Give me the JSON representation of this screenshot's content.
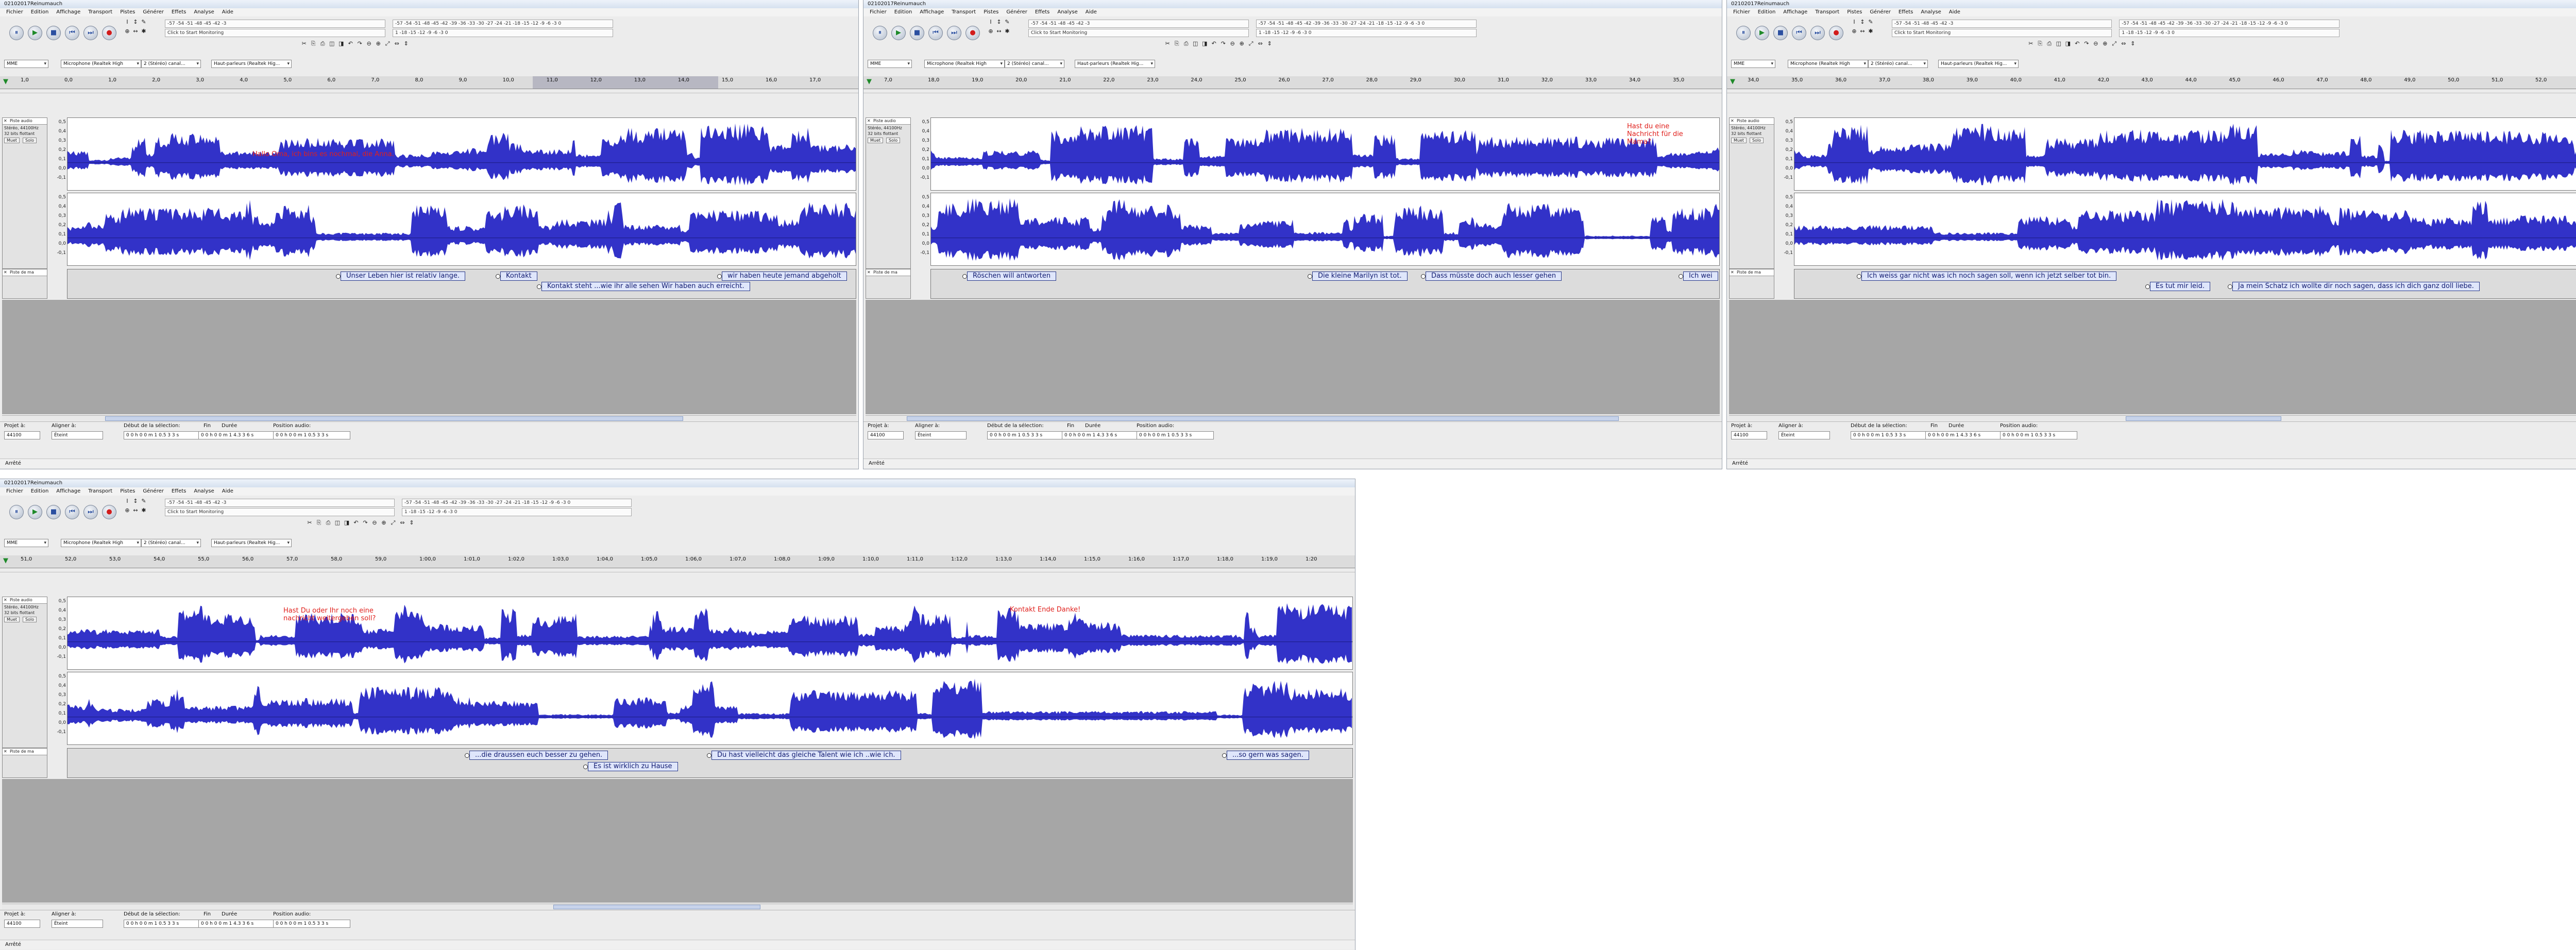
{
  "app": {
    "title": "02102017Reinumauch",
    "status": "Arrêté",
    "menus": [
      "Fichier",
      "Edition",
      "Affichage",
      "Transport",
      "Pistes",
      "Générer",
      "Effets",
      "Analyse",
      "Aide"
    ]
  },
  "toolbar": {
    "pause_icon": "pause-icon",
    "play_icon": "play-icon",
    "stop_icon": "stop-icon",
    "skip_start_icon": "skip-start-icon",
    "skip_end_icon": "skip-end-icon",
    "record_icon": "record-icon",
    "record_meter_text": "-57 -54 -51 -48 -45 -42 -3",
    "monitor_label": "Click to Start Monitoring",
    "record_meter_tail": "1 -18 -15 -12 -9 -6 -3 0",
    "play_meter_text": "-57 -54 -51 -48 -45 -42 -39 -36 -33 -30 -27 -24 -21 -18 -15 -12 -9 -6 -3 0",
    "host": "MME",
    "input_device": "Microphone (Realtek High",
    "channels": "2 (Stéréo) canal...",
    "output_device": "Haut-parleurs (Realtek Hig..."
  },
  "track": {
    "audio_name": "Piste audio",
    "audio_info_1": "Stéréo, 44100Hz",
    "audio_info_2": "32 bits flottant",
    "mute": "Muet",
    "solo": "Solo",
    "label_name": "Piste de ma"
  },
  "scale": [
    "0,5",
    "0,4",
    "0,3",
    "0,2",
    "0,1",
    "0,0",
    "-0,1"
  ],
  "windows": [
    {
      "ruler": [
        "1,0",
        "0,0",
        "1,0",
        "2,0",
        "3,0",
        "4,0",
        "5,0",
        "6,0",
        "7,0",
        "8,0",
        "9,0",
        "10,0",
        "11,0",
        "12,0",
        "13,0",
        "14,0",
        "15,0",
        "16,0",
        "17,0"
      ],
      "annotations": [
        {
          "text": "Hallo Oma, ich bins es nochmal, die Anna."
        }
      ],
      "labels": [
        {
          "text": "Unser Leben hier ist relativ lange."
        },
        {
          "text": "Kontakt"
        },
        {
          "text": "Kontakt steht ...wie ihr alle sehen Wir haben  auch erreicht."
        },
        {
          "text": "wir haben heute jemand abgeholt"
        }
      ]
    },
    {
      "ruler": [
        "7,0",
        "18,0",
        "19,0",
        "20,0",
        "21,0",
        "22,0",
        "23,0",
        "24,0",
        "25,0",
        "26,0",
        "27,0",
        "28,0",
        "29,0",
        "30,0",
        "31,0",
        "32,0",
        "33,0",
        "34,0",
        "35,0"
      ],
      "annotations": [
        {
          "text": "Hast du eine Nachricht für die Mama?"
        }
      ],
      "labels": [
        {
          "text": "Röschen will antworten"
        },
        {
          "text": "Die kleine Marilyn ist tot."
        },
        {
          "text": "Dass müsste doch auch lesser gehen"
        },
        {
          "text": "Ich wei"
        }
      ]
    },
    {
      "ruler": [
        "34,0",
        "35,0",
        "36,0",
        "37,0",
        "38,0",
        "39,0",
        "40,0",
        "41,0",
        "42,0",
        "43,0",
        "44,0",
        "45,0",
        "46,0",
        "47,0",
        "48,0",
        "49,0",
        "50,0",
        "51,0",
        "52,0"
      ],
      "annotations": [],
      "labels": [
        {
          "text": "Ich weiss gar nicht was ich noch sagen soll, wenn ich jetzt selber tot bin."
        },
        {
          "text": "Es tut mir leid."
        },
        {
          "text": "Ja mein Schatz ich wollte dir noch sagen, dass ich dich ganz doll liebe."
        }
      ]
    },
    {
      "ruler": [
        "51,0",
        "52,0",
        "53,0",
        "54,0",
        "55,0",
        "56,0",
        "57,0",
        "58,0",
        "59,0",
        "1:00,0",
        "1:01,0",
        "1:02,0",
        "1:03,0",
        "1:04,0",
        "1:05,0",
        "1:06,0",
        "1:07,0",
        "1:08,0",
        "1:09,0",
        "1:10,0",
        "1:11,0",
        "1:12,0",
        "1:13,0",
        "1:14,0",
        "1:15,0",
        "1:16,0",
        "1:17,0",
        "1:18,0",
        "1:19,0",
        "1:20"
      ],
      "annotations": [
        {
          "text": "Hast Du oder Ihr noch eine nachricht weitergeben soll?"
        },
        {
          "text": "Kontakt Ende Danke!"
        }
      ],
      "labels": [
        {
          "text": "...die draussen euch besser zu gehen."
        },
        {
          "text": "Es ist wirklich zu Hause"
        },
        {
          "text": "Du hast vielleicht das gleiche Talent wie ich ..wie ich."
        },
        {
          "text": "...so gern was sagen."
        }
      ]
    }
  ],
  "selection_toolbar": {
    "rate_label": "Projet à:",
    "rate": "44100",
    "snap_label": "Aligner à:",
    "snap": "Éteint",
    "start_label": "Début de la sélection:",
    "end_label": "Fin",
    "length_label": "Durée",
    "audio_pos_label": "Position audio:",
    "time_value": "0 0 h 0 0 m 1 0.5 3 3 s",
    "time_value_2": "0 0 h 0 0 m 1 4.3 3 6 s"
  },
  "colors": {
    "waveform": "#3232c8",
    "waveform_bg": "#ffffff",
    "selection": "#b7b7c2",
    "label_fill": "#dfe6fb",
    "annotation": "#e0201c"
  }
}
